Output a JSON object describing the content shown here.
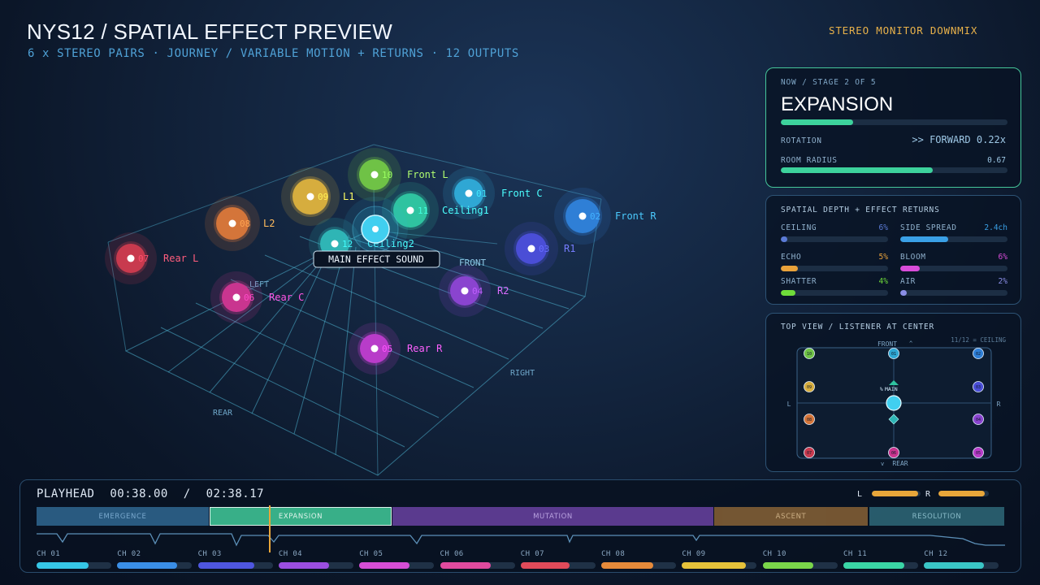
{
  "header": {
    "title": "NYS12 / SPATIAL EFFECT PREVIEW",
    "subtitle": "6 x STEREO PAIRS  ·  JOURNEY / VARIABLE MOTION + RETURNS  ·  12 OUTPUTS",
    "downmix": "STEREO MONITOR DOWNMIX"
  },
  "scene": {
    "labels": {
      "left": "LEFT",
      "right": "RIGHT",
      "front": "FRONT",
      "rear": "REAR"
    },
    "main_label": "MAIN EFFECT SOUND",
    "speakers": [
      {
        "num": "01",
        "name": "Front C",
        "color": "#2fa7d4"
      },
      {
        "num": "02",
        "name": "Front R",
        "color": "#2f7fd6"
      },
      {
        "num": "03",
        "name": "R1",
        "color": "#4a4ed6"
      },
      {
        "num": "04",
        "name": "R2",
        "color": "#8a44cf"
      },
      {
        "num": "05",
        "name": "Rear R",
        "color": "#b83cc9"
      },
      {
        "num": "06",
        "name": "Rear C",
        "color": "#c9358f"
      },
      {
        "num": "07",
        "name": "Rear L",
        "color": "#c83a4e"
      },
      {
        "num": "08",
        "name": "L2",
        "color": "#d4753a"
      },
      {
        "num": "09",
        "name": "L1",
        "color": "#d6ad3e"
      },
      {
        "num": "10",
        "name": "Front L",
        "color": "#6fc246"
      },
      {
        "num": "11",
        "name": "Ceiling1",
        "color": "#2fc3a0"
      },
      {
        "num": "12",
        "name": "Ceiling2",
        "color": "#2fb5b5"
      }
    ]
  },
  "now_panel": {
    "crumb": "NOW  /  STAGE 2 OF 5",
    "stage": "EXPANSION",
    "stage_progress": 0.32,
    "rotation_label": "ROTATION",
    "rotation_value": ">> FORWARD  0.22x",
    "radius_label": "ROOM RADIUS",
    "radius_value": "0.67",
    "radius_level": 0.67
  },
  "depth_panel": {
    "title": "SPATIAL DEPTH + EFFECT RETURNS",
    "items": [
      {
        "label": "CEILING",
        "value": "6%",
        "level": 0.06,
        "color": "#5b7bd6"
      },
      {
        "label": "SIDE SPREAD",
        "value": "2.4ch",
        "level": 0.45,
        "color": "#3aa0e6"
      },
      {
        "label": "ECHO",
        "value": "5%",
        "level": 0.16,
        "color": "#e8a13a"
      },
      {
        "label": "BLOOM",
        "value": "6%",
        "level": 0.18,
        "color": "#d94cd9"
      },
      {
        "label": "SHATTER",
        "value": "4%",
        "level": 0.14,
        "color": "#6fdc3a"
      },
      {
        "label": "AIR",
        "value": "2%",
        "level": 0.05,
        "color": "#8a8ee6"
      }
    ]
  },
  "top_view": {
    "title": "TOP VIEW  /  LISTENER AT CENTER",
    "note": "11/12 = CEILING",
    "front": "FRONT",
    "rear": "REAR",
    "left": "L",
    "right": "R",
    "main": "MAIN",
    "up_glyph": "^",
    "down_glyph": "v",
    "main_glyph": "%"
  },
  "timeline": {
    "playhead_label": "PLAYHEAD",
    "current": "00:38.00",
    "separator": "/",
    "total": "02:38.17",
    "meter_l_label": "L",
    "meter_r_label": "R",
    "meter_l": 0.95,
    "meter_r": 0.92,
    "segments": [
      {
        "label": "EMERGENCE",
        "color": "#2b5e86",
        "text": "#7fb0d6"
      },
      {
        "label": "EXPANSION",
        "color": "#3bb88e",
        "text": "#eafff6"
      },
      {
        "label": "MUTATION",
        "color": "#5a3a8e",
        "text": "#b9a3e0"
      },
      {
        "label": "ASCENT",
        "color": "#7a5a34",
        "text": "#d6b78a"
      },
      {
        "label": "RESOLUTION",
        "color": "#2a5f70",
        "text": "#8fc3d0"
      }
    ],
    "channels": [
      {
        "label": "CH 01",
        "level": 0.7,
        "color": "#36c6e6"
      },
      {
        "label": "CH 02",
        "level": 0.8,
        "color": "#3a8ee6"
      },
      {
        "label": "CH 03",
        "level": 0.75,
        "color": "#4e56e0"
      },
      {
        "label": "CH 04",
        "level": 0.68,
        "color": "#9a4ee0"
      },
      {
        "label": "CH 05",
        "level": 0.67,
        "color": "#d64ed6"
      },
      {
        "label": "CH 06",
        "level": 0.68,
        "color": "#e04a9e"
      },
      {
        "label": "CH 07",
        "level": 0.65,
        "color": "#e04a5a"
      },
      {
        "label": "CH 08",
        "level": 0.7,
        "color": "#e68a3a"
      },
      {
        "label": "CH 09",
        "level": 0.85,
        "color": "#e6c23a"
      },
      {
        "label": "CH 10",
        "level": 0.68,
        "color": "#7ad64a"
      },
      {
        "label": "CH 11",
        "level": 0.82,
        "color": "#3ad6a6"
      },
      {
        "label": "CH 12",
        "level": 0.8,
        "color": "#3ac6c6"
      }
    ]
  }
}
